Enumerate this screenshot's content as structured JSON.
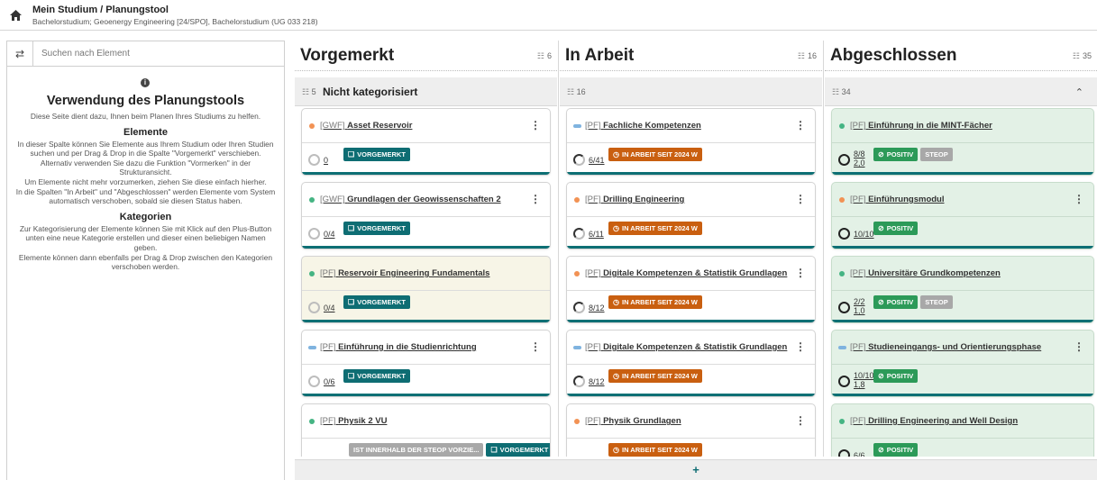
{
  "header": {
    "title": "Mein Studium / Planungstool",
    "subtitle": "Bachelorstudium; Geoenergy Engineering [24/SPO], Bachelorstudium (UG 033 218)"
  },
  "sidebar": {
    "search_placeholder": "Suchen nach Element",
    "heading": "Verwendung des Planungstools",
    "intro": "Diese Seite dient dazu, Ihnen beim Planen Ihres Studiums zu helfen.",
    "elements_heading": "Elemente",
    "elements_text": "In dieser Spalte können Sie Elemente aus Ihrem Studium oder Ihren Studien suchen und per Drag & Drop in die Spalte \"Vorgemerkt\" verschieben. Alternativ verwenden Sie dazu die Funktion \"Vormerken\" in der Strukturansicht.\nUm Elemente nicht mehr vorzumerken, ziehen Sie diese einfach hierher.\nIn die Spalten \"In Arbeit\" und \"Abgeschlossen\" werden Elemente vom System automatisch verschoben, sobald sie diesen Status haben.",
    "categories_heading": "Kategorien",
    "categories_text": "Zur Kategorisierung der Elemente können Sie mit Klick auf den Plus-Button unten eine neue Kategorie erstellen und dieser einen beliebigen Namen geben.\nElemente können dann ebenfalls per Drag & Drop zwischen den Kategorien verschoben werden."
  },
  "columns": [
    {
      "title": "Vorgemerkt",
      "count": "6",
      "group_count": "5",
      "group_title": "Nicht kategorisiert",
      "cards": [
        {
          "marker": "orange",
          "prefix": "[GWF]",
          "name": "Asset Reservoir",
          "progress": "0",
          "badges": [
            {
              "text": "VORGEMERKT",
              "color": "teal",
              "icon": "bookmark-icon"
            }
          ]
        },
        {
          "marker": "green",
          "prefix": "[GWF]",
          "name": "Grundlagen der Geowissenschaften 2",
          "progress": "0/4",
          "badges": [
            {
              "text": "VORGEMERKT",
              "color": "teal",
              "icon": "bookmark-icon"
            }
          ]
        },
        {
          "marker": "green",
          "prefix": "[PF]",
          "name": "Reservoir Engineering Fundamentals",
          "progress": "0/4",
          "badges": [
            {
              "text": "VORGEMERKT",
              "color": "teal",
              "icon": "bookmark-icon"
            }
          ]
        },
        {
          "marker": "blue",
          "prefix": "[PF]",
          "name": "Einführung in die Studienrichtung",
          "progress": "0/6",
          "badges": [
            {
              "text": "VORGEMERKT",
              "color": "teal",
              "icon": "bookmark-icon"
            }
          ]
        },
        {
          "marker": "green",
          "prefix": "[PF]",
          "name": "Physik 2 VU",
          "progress": "",
          "badges": [
            {
              "text": "IST INNERHALB DER STEOP VORZIE...",
              "color": "grey"
            },
            {
              "text": "VORGEMERKT",
              "color": "teal",
              "icon": "bookmark-icon"
            }
          ]
        }
      ]
    },
    {
      "title": "In Arbeit",
      "count": "16",
      "group_count": "16",
      "group_title": "",
      "cards": [
        {
          "marker": "blue",
          "prefix": "[PF]",
          "name": "Fachliche Kompetenzen",
          "progress": "6/41",
          "badges": [
            {
              "text": "IN ARBEIT SEIT 2024 W",
              "color": "orange",
              "icon": "clock-icon"
            }
          ]
        },
        {
          "marker": "orange",
          "prefix": "[PF]",
          "name": "Drilling Engineering",
          "progress": "6/11",
          "badges": [
            {
              "text": "IN ARBEIT SEIT 2024 W",
              "color": "orange",
              "icon": "clock-icon"
            }
          ]
        },
        {
          "marker": "orange",
          "prefix": "[PF]",
          "name": "Digitale Kompetenzen & Statistik Grundlagen",
          "progress": "8/12",
          "badges": [
            {
              "text": "IN ARBEIT SEIT 2024 W",
              "color": "orange",
              "icon": "clock-icon"
            }
          ]
        },
        {
          "marker": "blue",
          "prefix": "[PF]",
          "name": "Digitale Kompetenzen & Statistik Grundlagen",
          "progress": "8/12",
          "badges": [
            {
              "text": "IN ARBEIT SEIT 2024 W",
              "color": "orange",
              "icon": "clock-icon"
            }
          ]
        },
        {
          "marker": "orange",
          "prefix": "[PF]",
          "name": "Physik Grundlagen",
          "progress": "",
          "badges": [
            {
              "text": "IN ARBEIT SEIT 2024 W",
              "color": "orange",
              "icon": "clock-icon"
            }
          ]
        }
      ]
    },
    {
      "title": "Abgeschlossen",
      "count": "35",
      "group_count": "34",
      "group_title": "",
      "cards": [
        {
          "marker": "green",
          "prefix": "[PF]",
          "name": "Einführung in die MINT-Fächer",
          "progress": "8/8",
          "grade": "2,0",
          "badges": [
            {
              "text": "POSITIV",
              "color": "green",
              "icon": "check-circle-icon"
            },
            {
              "text": "STEOP",
              "color": "grey"
            }
          ]
        },
        {
          "marker": "orange",
          "prefix": "[PF]",
          "name": "Einführungsmodul",
          "progress": "10/10",
          "grade": "",
          "badges": [
            {
              "text": "POSITIV",
              "color": "green",
              "icon": "check-circle-icon"
            }
          ]
        },
        {
          "marker": "green",
          "prefix": "[PF]",
          "name": "Universitäre Grundkompetenzen",
          "progress": "2/2",
          "grade": "1,0",
          "badges": [
            {
              "text": "POSITIV",
              "color": "green",
              "icon": "check-circle-icon"
            },
            {
              "text": "STEOP",
              "color": "grey"
            }
          ]
        },
        {
          "marker": "blue",
          "prefix": "[PF]",
          "name": "Studieneingangs- und Orientierungsphase",
          "progress": "10/10",
          "grade": "1,8",
          "badges": [
            {
              "text": "POSITIV",
              "color": "green",
              "icon": "check-circle-icon"
            }
          ]
        },
        {
          "marker": "green",
          "prefix": "[PF]",
          "name": "Drilling Engineering and Well Design",
          "progress": "6/6",
          "grade": "",
          "badges": [
            {
              "text": "POSITIV",
              "color": "green",
              "icon": "check-circle-icon"
            }
          ]
        }
      ]
    }
  ],
  "add_category_label": "+",
  "colors": {
    "accent": "#0e6d73",
    "in_progress": "#c95f10",
    "positive": "#2c9a58",
    "done_card_bg": "#e3f1e6"
  }
}
